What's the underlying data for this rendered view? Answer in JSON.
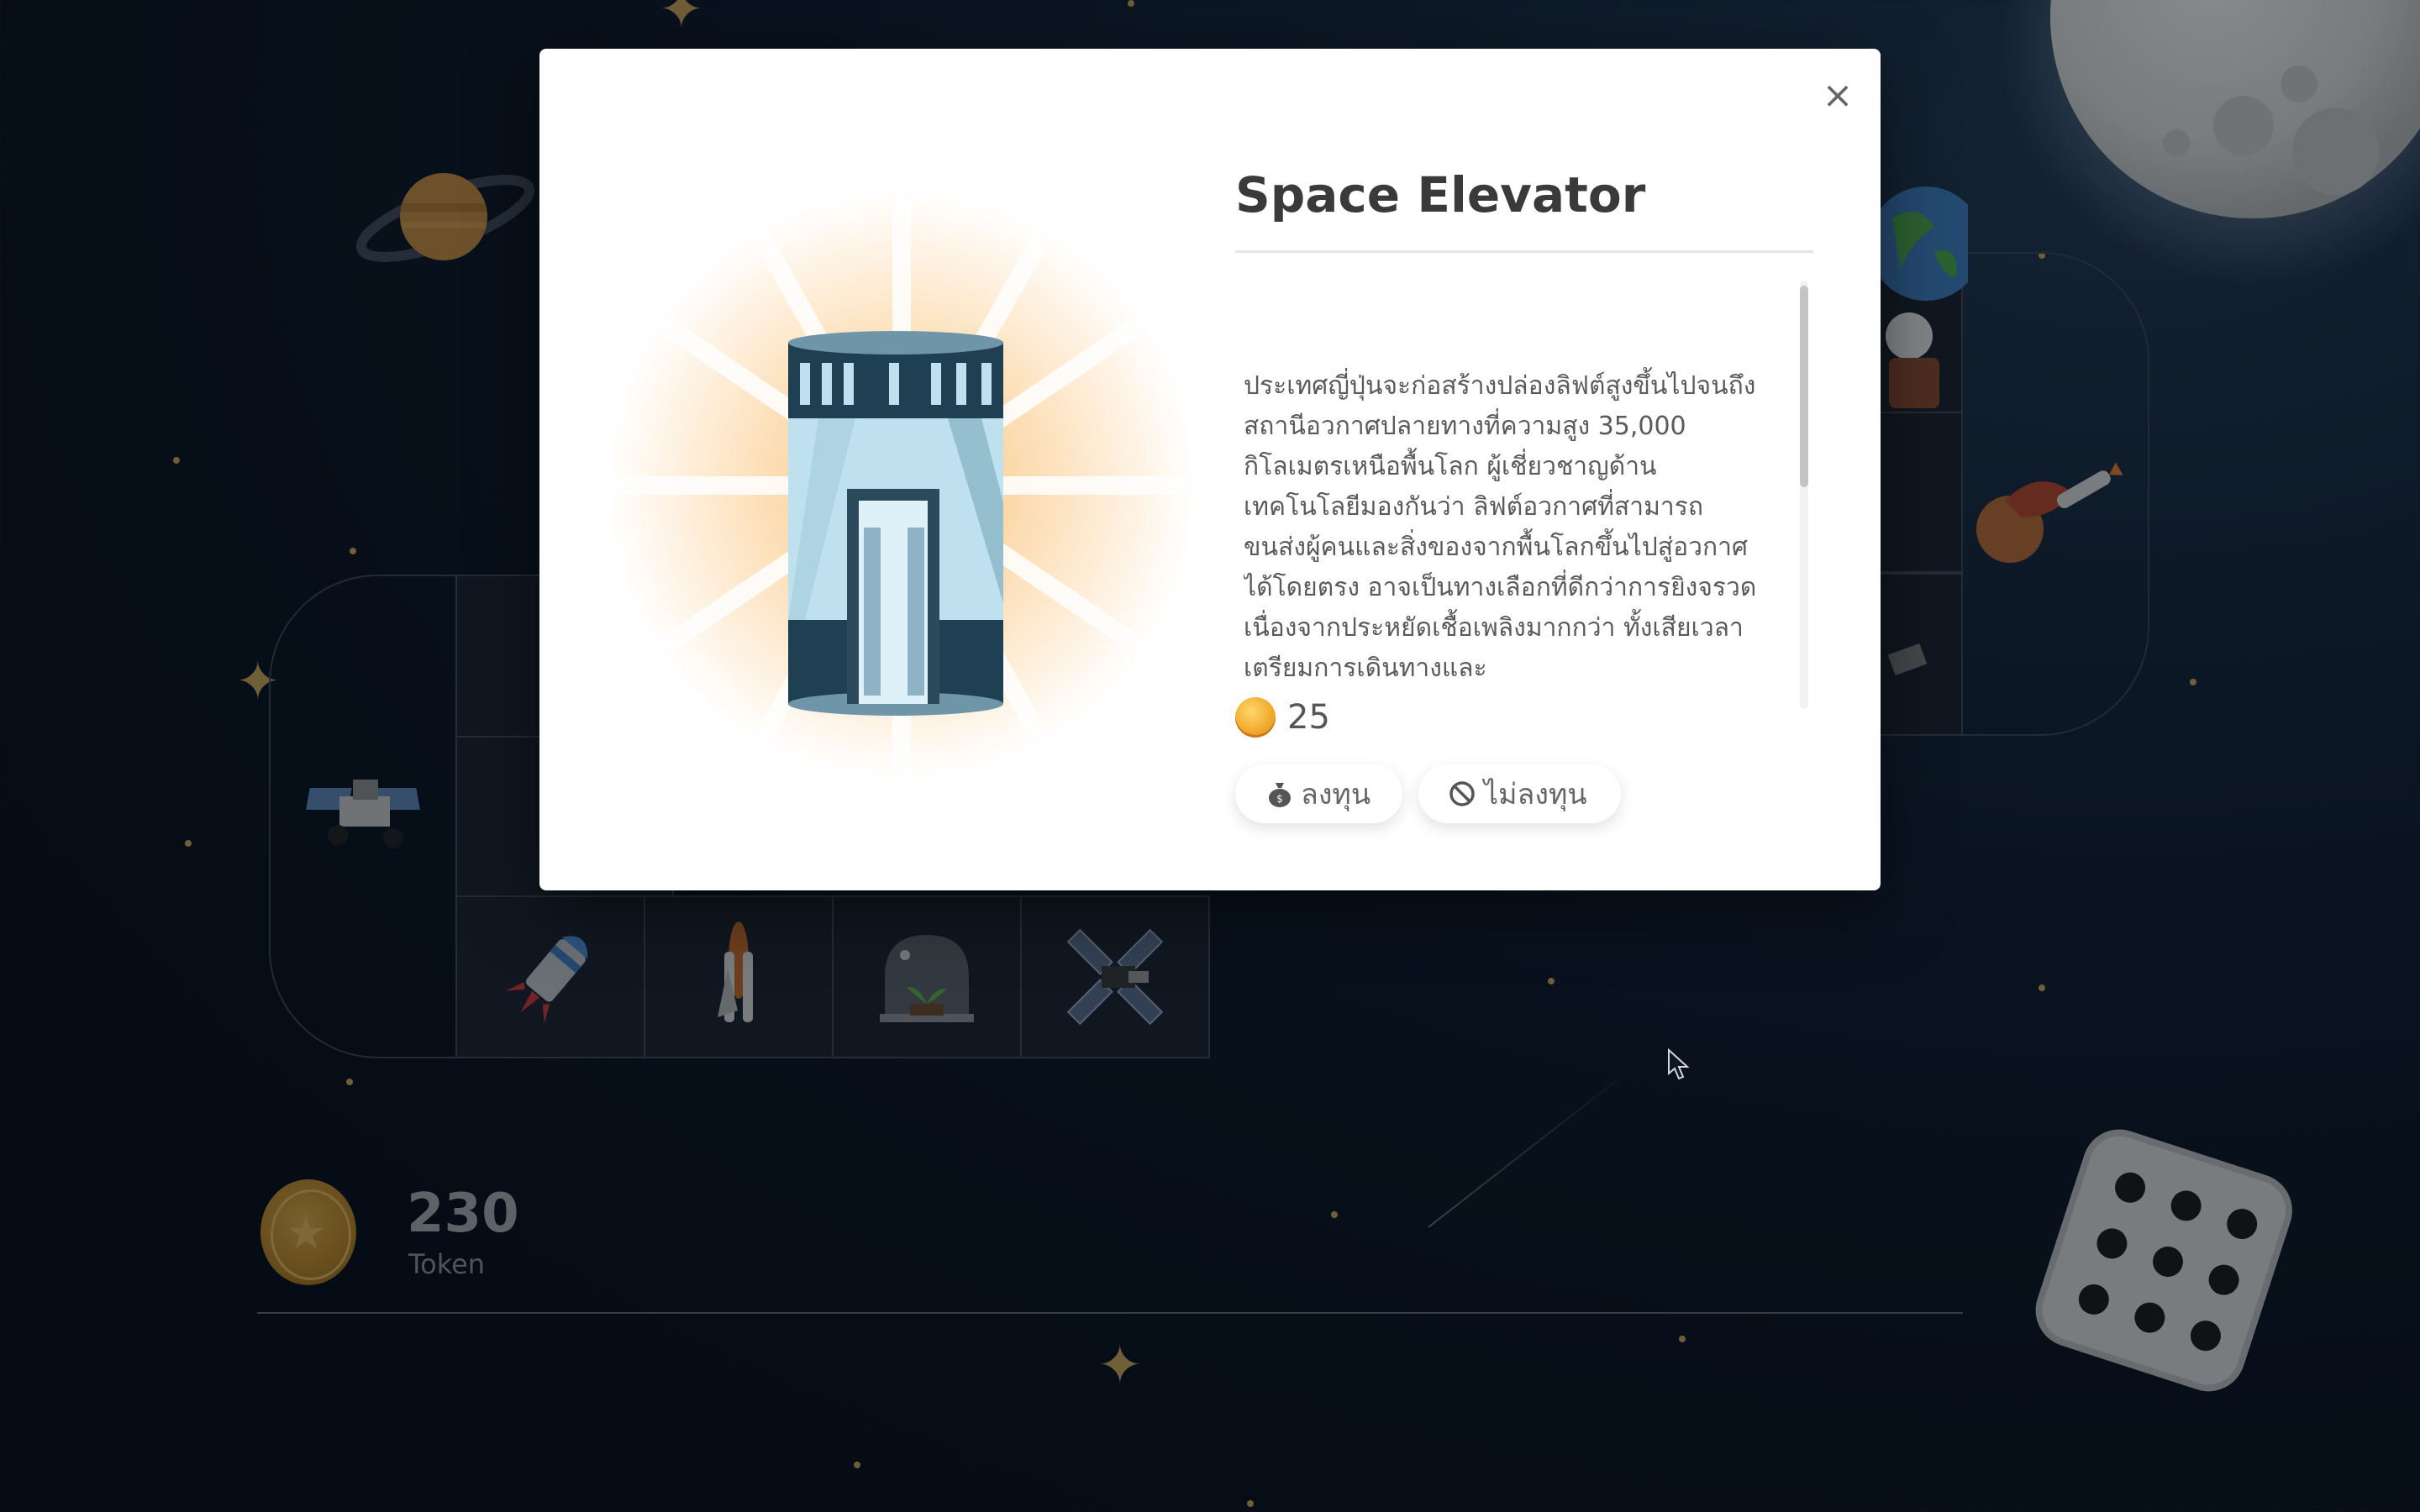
{
  "modal": {
    "title": "Space Elevator",
    "description": "ประเทศญี่ปุ่นจะก่อสร้างปล่องลิฟต์สูงขึ้นไปจนถึงสถานีอวกาศปลายทางที่ความสูง 35,000 กิโลเมตรเหนือพื้นโลก ผู้เชี่ยวชาญด้านเทคโนโลยีมองกันว่า ลิฟต์อวกาศที่สามารถขนส่งผู้คนและสิ่งของจากพื้นโลกขึ้นไปสู่อวกาศได้โดยตรง อาจเป็นทางเลือกที่ดีกว่าการยิงจรวด เนื่องจากประหยัดเชื้อเพลิงมากกว่า ทั้งเสียเวลาเตรียมการเดินทางและ",
    "cost": "25",
    "invest_label": "ลงทุน",
    "decline_label": "ไม่ลงทุน",
    "close_label": "×"
  },
  "hud": {
    "token_value": "230",
    "token_label": "Token"
  },
  "colors": {
    "accent_gold": "#c9a25a",
    "background": "#0c1626",
    "modal_bg": "#ffffff"
  },
  "icons": [
    "close-icon",
    "coin-icon",
    "money-bag-icon",
    "no-entry-icon",
    "moon-icon",
    "saturn-icon",
    "dice-icon",
    "rocket-icon",
    "space-shuttle-icon",
    "greenhouse-icon",
    "satellite-icon",
    "rover-icon",
    "earth-astronaut-icon",
    "mars-icon",
    "space-elevator-icon"
  ]
}
